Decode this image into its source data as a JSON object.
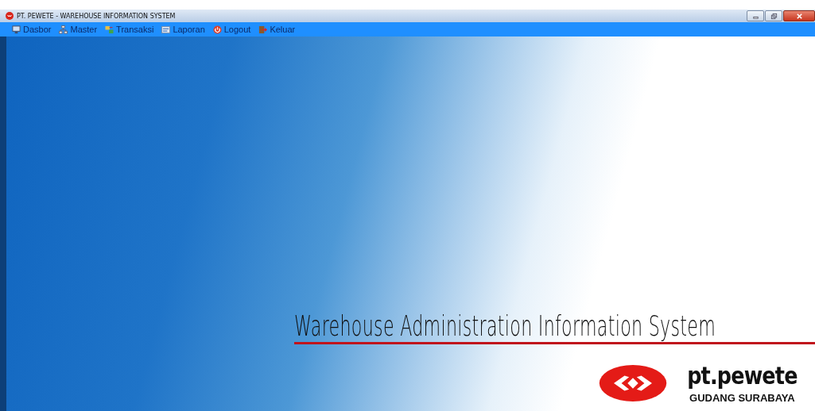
{
  "window": {
    "title": "PT. PEWETE - WAREHOUSE INFORMATION SYSTEM"
  },
  "menu": [
    {
      "label": "Dasbor"
    },
    {
      "label": "Master"
    },
    {
      "label": "Transaksi"
    },
    {
      "label": "Laporan"
    },
    {
      "label": "Logout"
    },
    {
      "label": "Keluar"
    }
  ],
  "hero": {
    "title": "Warehouse Administration Information System"
  },
  "logo": {
    "name": "pt.pewete",
    "subtitle": "GUDANG SURABAYA"
  }
}
